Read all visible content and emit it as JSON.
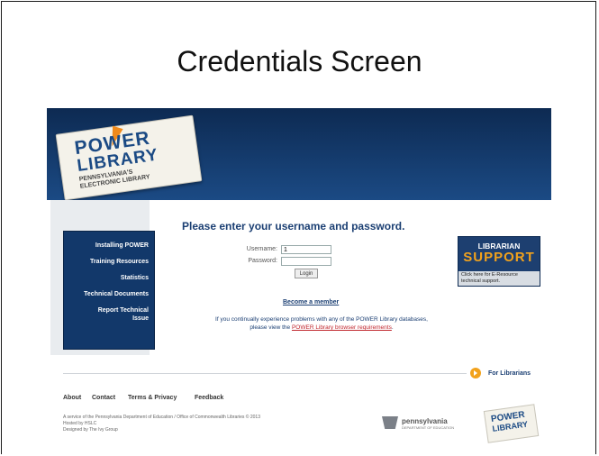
{
  "slide": {
    "title": "Credentials Screen"
  },
  "logo": {
    "power": "POWER",
    "library": "LIBRARY",
    "tagline_1": "PENNSYLVANIA'S",
    "tagline_2": "ELECTRONIC LIBRARY"
  },
  "sidebar": {
    "items": [
      {
        "label": "Installing POWER"
      },
      {
        "label": "Training Resources"
      },
      {
        "label": "Statistics"
      },
      {
        "label": "Technical Documents"
      },
      {
        "label": "Report Technical"
      },
      {
        "label": "Issue"
      }
    ]
  },
  "login": {
    "heading": "Please enter your username and password.",
    "username_label": "Username:",
    "username_value": "1",
    "password_label": "Password:",
    "password_value": "",
    "login_button": "Login",
    "become_member": "Become a member",
    "notice_text": "If you continually experience problems with any of the POWER Library databases,",
    "notice_prefix": "please view the",
    "notice_link": "POWER Library browser requirements",
    "notice_suffix": "."
  },
  "support_badge": {
    "title_1": "LIBRARIAN",
    "title_2": "SUPPORT",
    "caption": "Click here for E-Resource technical support."
  },
  "footer": {
    "for_librarians": "For Librarians",
    "links": [
      "About",
      "Contact",
      "Terms & Privacy",
      "Feedback"
    ],
    "credit_1": "A service of the Pennsylvania Department of Education / Office of Commonwealth Libraries © 2013",
    "credit_2": "Hosted by HSLC",
    "credit_3": "Designed by The Ivy Group",
    "pa_name": "pennsylvania",
    "pa_sub": "DEPARTMENT OF EDUCATION",
    "mini_power": "POWER",
    "mini_library": "LIBRARY"
  },
  "colors": {
    "header_navy": "#1b4a84",
    "accent_orange": "#f2a21c",
    "link_red": "#c0262d"
  }
}
